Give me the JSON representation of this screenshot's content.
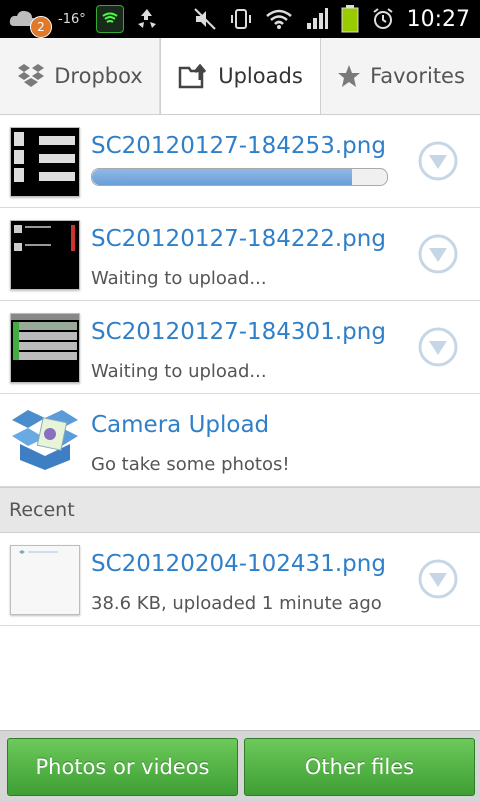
{
  "status_bar": {
    "notification_count": "2",
    "temperature": "-16°",
    "time": "10:27"
  },
  "tabs": [
    {
      "label": "Dropbox",
      "icon": "dropbox-icon"
    },
    {
      "label": "Uploads",
      "icon": "upload-folder-icon",
      "active": true
    },
    {
      "label": "Favorites",
      "icon": "star-icon"
    }
  ],
  "uploads": [
    {
      "filename": "SC20120127-184253.png",
      "progress": 0.88
    },
    {
      "filename": "SC20120127-184222.png",
      "status": "Waiting to upload..."
    },
    {
      "filename": "SC20120127-184301.png",
      "status": "Waiting to upload..."
    }
  ],
  "camera_upload": {
    "title": "Camera Upload",
    "subtitle": "Go take some photos!"
  },
  "recent": {
    "header": "Recent",
    "items": [
      {
        "filename": "SC20120204-102431.png",
        "info": "38.6 KB, uploaded 1 minute ago"
      }
    ]
  },
  "bottom_buttons": {
    "photos": "Photos or videos",
    "other": "Other files"
  },
  "colors": {
    "link_blue": "#2f7fc9",
    "button_green": "#4fb443",
    "progress_blue": "#7aaee2"
  }
}
